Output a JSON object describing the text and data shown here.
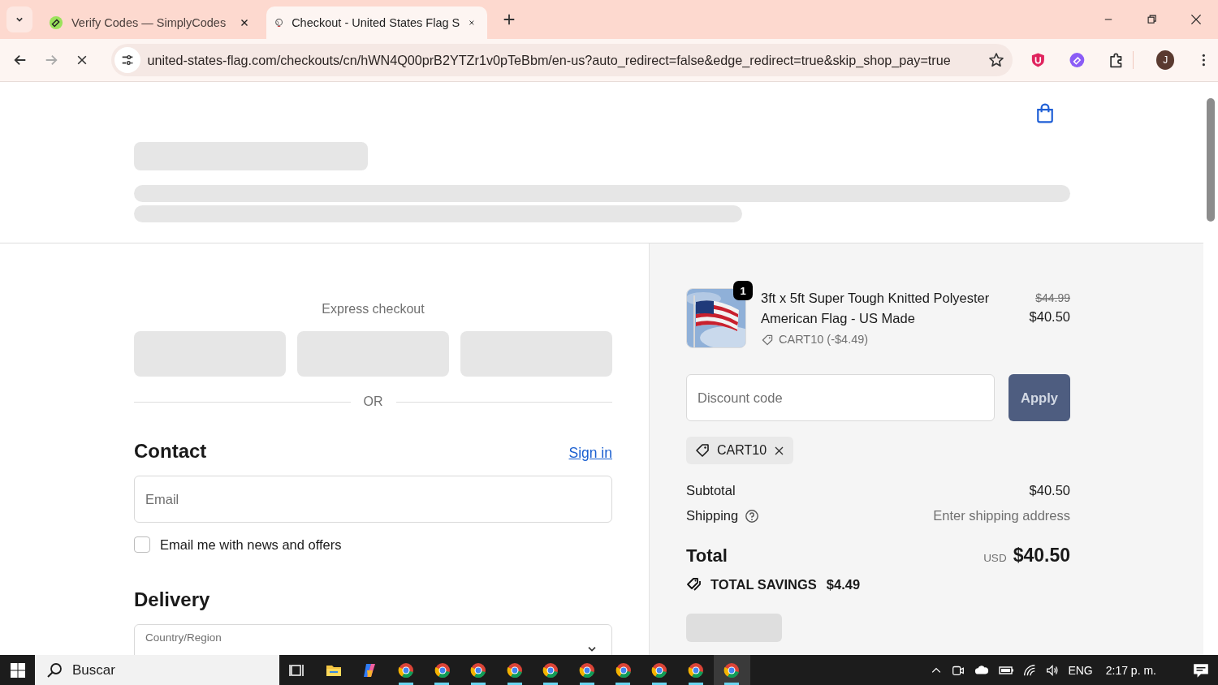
{
  "browser": {
    "tabs": [
      {
        "title": "Verify Codes — SimplyCodes",
        "selected": false
      },
      {
        "title": "Checkout - United States Flag S",
        "selected": true
      }
    ],
    "url": "united-states-flag.com/checkouts/cn/hWN4Q00prB2YTZr1v0pTeBbm/en-us?auto_redirect=false&edge_redirect=true&skip_shop_pay=true",
    "loading": true,
    "profile_initial": "J"
  },
  "checkout": {
    "express_checkout": {
      "title": "Express checkout",
      "separator": "OR"
    },
    "contact": {
      "heading": "Contact",
      "sign_in": "Sign in",
      "email": {
        "placeholder": "Email"
      },
      "newsletter": {
        "label": "Email me with news and offers",
        "checked": false
      }
    },
    "delivery": {
      "heading": "Delivery",
      "country": {
        "label": "Country/Region"
      }
    }
  },
  "summary": {
    "item": {
      "quantity": "1",
      "name": "3ft x 5ft Super Tough Knitted Polyester American Flag - US Made",
      "discount": "CART10 (-$4.49)",
      "original_price": "$44.99",
      "price": "$40.50"
    },
    "discount_field": {
      "placeholder": "Discount code"
    },
    "apply_button": "Apply",
    "applied_code": "CART10",
    "lines": [
      {
        "label": "Subtotal",
        "value": "$40.50",
        "help": false,
        "muted": false
      },
      {
        "label": "Shipping",
        "value": "Enter shipping address",
        "help": true,
        "muted": true
      }
    ],
    "total": {
      "label": "Total",
      "currency": "USD",
      "value": "$40.50"
    },
    "savings": {
      "label": "TOTAL SAVINGS",
      "value": "$4.49"
    }
  },
  "taskbar": {
    "search": {
      "placeholder": "Buscar"
    },
    "apps": [
      {
        "kind": "taskview",
        "running": false,
        "selected": false
      },
      {
        "kind": "files",
        "running": false,
        "selected": false
      },
      {
        "kind": "copilot",
        "running": false,
        "selected": false
      },
      {
        "kind": "browser",
        "running": true,
        "selected": false
      },
      {
        "kind": "browser",
        "running": true,
        "selected": false
      },
      {
        "kind": "browser",
        "running": true,
        "selected": false
      },
      {
        "kind": "browser",
        "running": true,
        "selected": false
      },
      {
        "kind": "browser",
        "running": true,
        "selected": false
      },
      {
        "kind": "browser",
        "running": true,
        "selected": false
      },
      {
        "kind": "browser",
        "running": true,
        "selected": false
      },
      {
        "kind": "browser",
        "running": true,
        "selected": false
      },
      {
        "kind": "browser",
        "running": true,
        "selected": false
      },
      {
        "kind": "browser",
        "running": true,
        "selected": true
      }
    ],
    "language": "ENG",
    "time": "2:17 p. m."
  }
}
